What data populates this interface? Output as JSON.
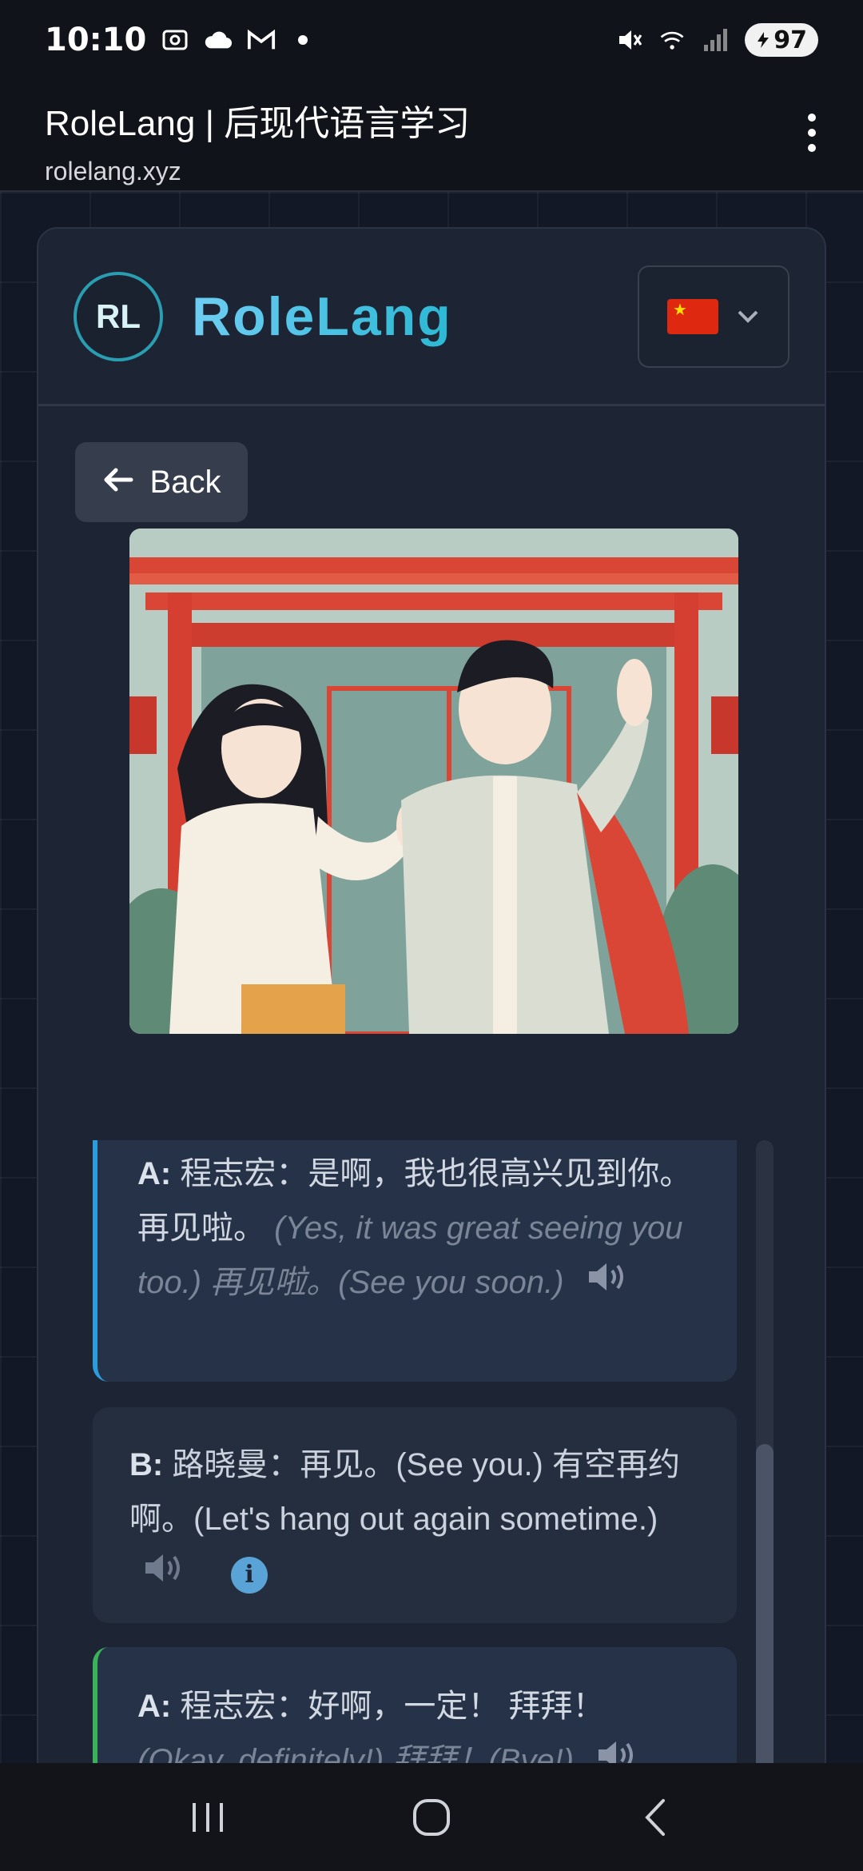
{
  "status_bar": {
    "time": "10:10",
    "battery": "97",
    "icons": [
      "screenshot-icon",
      "cloud-icon",
      "gmail-icon",
      "notification-dot",
      "mute-icon",
      "wifi-icon",
      "signal-icon",
      "battery-icon"
    ]
  },
  "browser": {
    "title": "RoleLang | 后现代语言学习",
    "url": "rolelang.xyz",
    "menu_icon": "kebab-menu-icon"
  },
  "app": {
    "logo_text": "RL",
    "name": "RoleLang",
    "language_flag": "china-flag",
    "back_label": "Back"
  },
  "dialogue": [
    {
      "speaker": "A:",
      "zh": "程志宏：是啊，我也很高兴见到你。 再见啦。",
      "translation": "(Yes, it was great seeing you too.) 再见啦。(See you soon.)",
      "accent": "#2d9cdb"
    },
    {
      "speaker": "B:",
      "text": "路晓曼：再见。(See you.) 有空再约啊。(Let's hang out again sometime.)",
      "accent": "none"
    },
    {
      "speaker": "A:",
      "zh": "程志宏：好啊，一定！ 拜拜！",
      "translation": "(Okay, definitely!) 拜拜！(Bye!)",
      "accent": "#39b25a"
    }
  ],
  "colors": {
    "accent_cyan": "#2bb8d4",
    "card_bg": "#1d2433",
    "bubble_bg": "#263247"
  }
}
